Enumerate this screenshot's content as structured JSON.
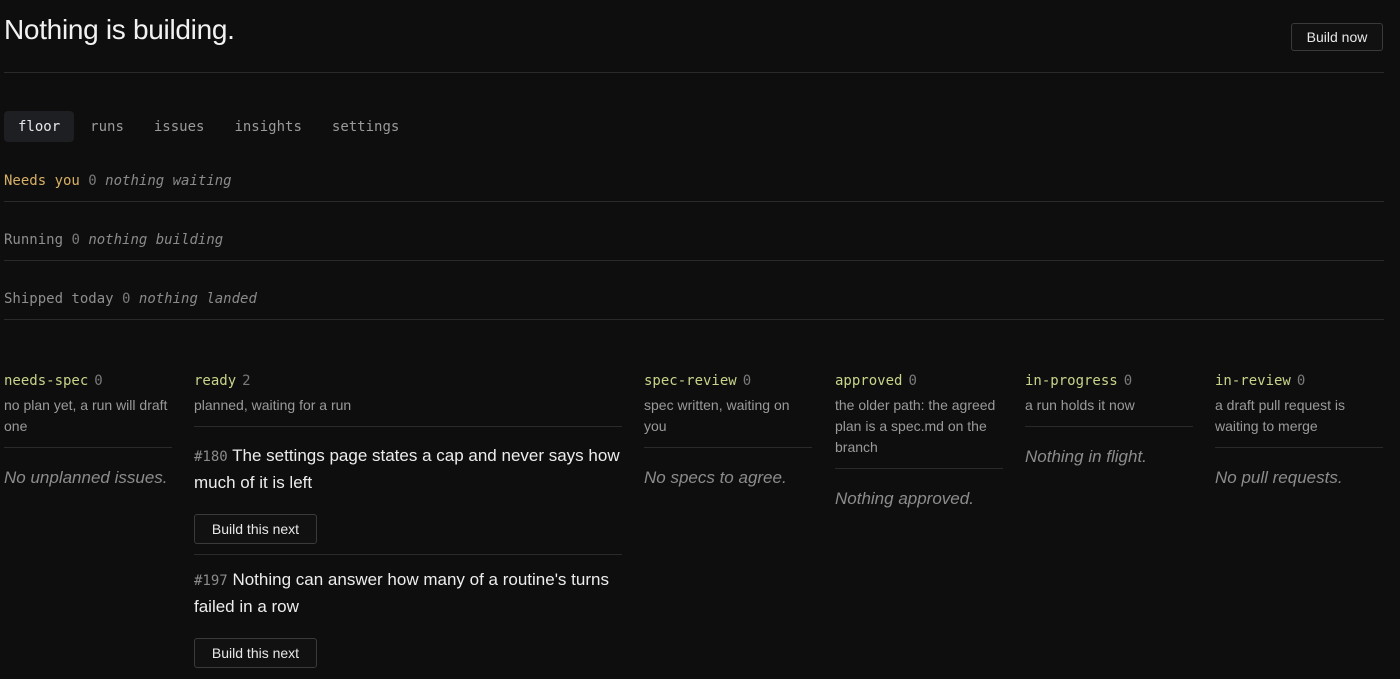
{
  "header": {
    "title": "Nothing is building.",
    "build_now_label": "Build now"
  },
  "tabs": [
    {
      "label": "floor",
      "active": true
    },
    {
      "label": "runs",
      "active": false
    },
    {
      "label": "issues",
      "active": false
    },
    {
      "label": "insights",
      "active": false
    },
    {
      "label": "settings",
      "active": false
    }
  ],
  "stats": [
    {
      "label": "Needs you",
      "count": "0",
      "note": "nothing waiting",
      "color": "#d8b065"
    },
    {
      "label": "Running",
      "count": "0",
      "note": "nothing building"
    },
    {
      "label": "Shipped today",
      "count": "0",
      "note": "nothing landed"
    }
  ],
  "columns": [
    {
      "name": "needs-spec",
      "count": "0",
      "desc": "no plan yet, a run will draft one",
      "empty": "No unplanned issues."
    },
    {
      "name": "ready",
      "count": "2",
      "desc": "planned, waiting for a run",
      "issues": [
        {
          "number": "#180",
          "title": "The settings page states a cap and never says how much of it is left",
          "action": "Build this next"
        },
        {
          "number": "#197",
          "title": "Nothing can answer how many of a routine's turns failed in a row",
          "action": "Build this next"
        }
      ]
    },
    {
      "name": "spec-review",
      "count": "0",
      "desc": "spec written, waiting on you",
      "empty": "No specs to agree."
    },
    {
      "name": "approved",
      "count": "0",
      "desc": "the older path: the agreed plan is a spec.md on the branch",
      "empty": "Nothing approved."
    },
    {
      "name": "in-progress",
      "count": "0",
      "desc": "a run holds it now",
      "empty": "Nothing in flight."
    },
    {
      "name": "in-review",
      "count": "0",
      "desc": "a draft pull request is waiting to merge",
      "empty": "No pull requests."
    }
  ],
  "colors": {
    "background": "#0e0e0f",
    "accent_column": "#c9d48a",
    "warn": "#d8b065"
  }
}
